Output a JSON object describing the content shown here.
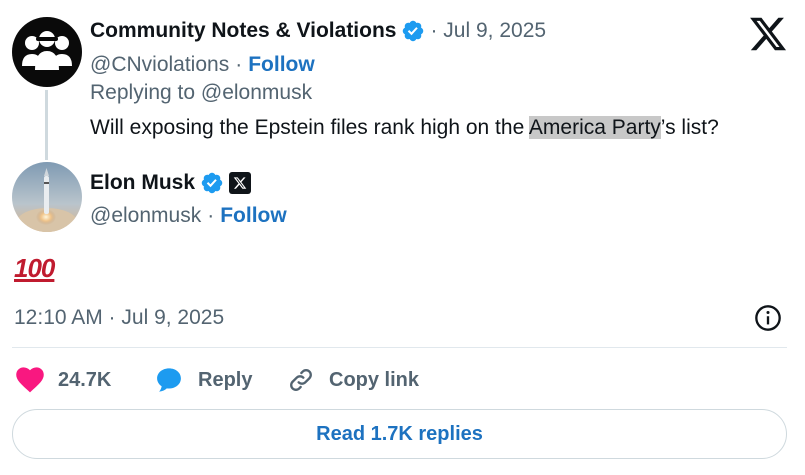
{
  "parent_tweet": {
    "display_name": "Community Notes & Violations",
    "date": "· Jul 9, 2025",
    "handle": "@CNviolations",
    "separator": "·",
    "follow_label": "Follow",
    "replying_to": "Replying to @elonmusk",
    "text_before": "Will exposing the Epstein files rank high on the ",
    "text_highlight": "America Party",
    "text_after": "’s list?"
  },
  "main_tweet": {
    "display_name": "Elon Musk",
    "handle": "@elonmusk",
    "separator": "·",
    "follow_label": "Follow",
    "body_emoji": "100",
    "timestamp": "12:10 AM · Jul 9, 2025"
  },
  "actions": {
    "likes_count": "24.7K",
    "reply_label": "Reply",
    "copy_link_label": "Copy link"
  },
  "read_replies_label": "Read 1.7K replies",
  "icons": {
    "verified": "verified-badge-icon",
    "x_logo": "x-logo-icon",
    "heart": "heart-icon",
    "reply": "speech-bubble-icon",
    "link": "link-icon",
    "info": "info-icon"
  },
  "colors": {
    "link_blue": "#1d72c0",
    "verified_blue": "#1d9bf0",
    "like_pink": "#f91880",
    "muted_text": "#536471",
    "highlight": "#c8c8c8"
  }
}
